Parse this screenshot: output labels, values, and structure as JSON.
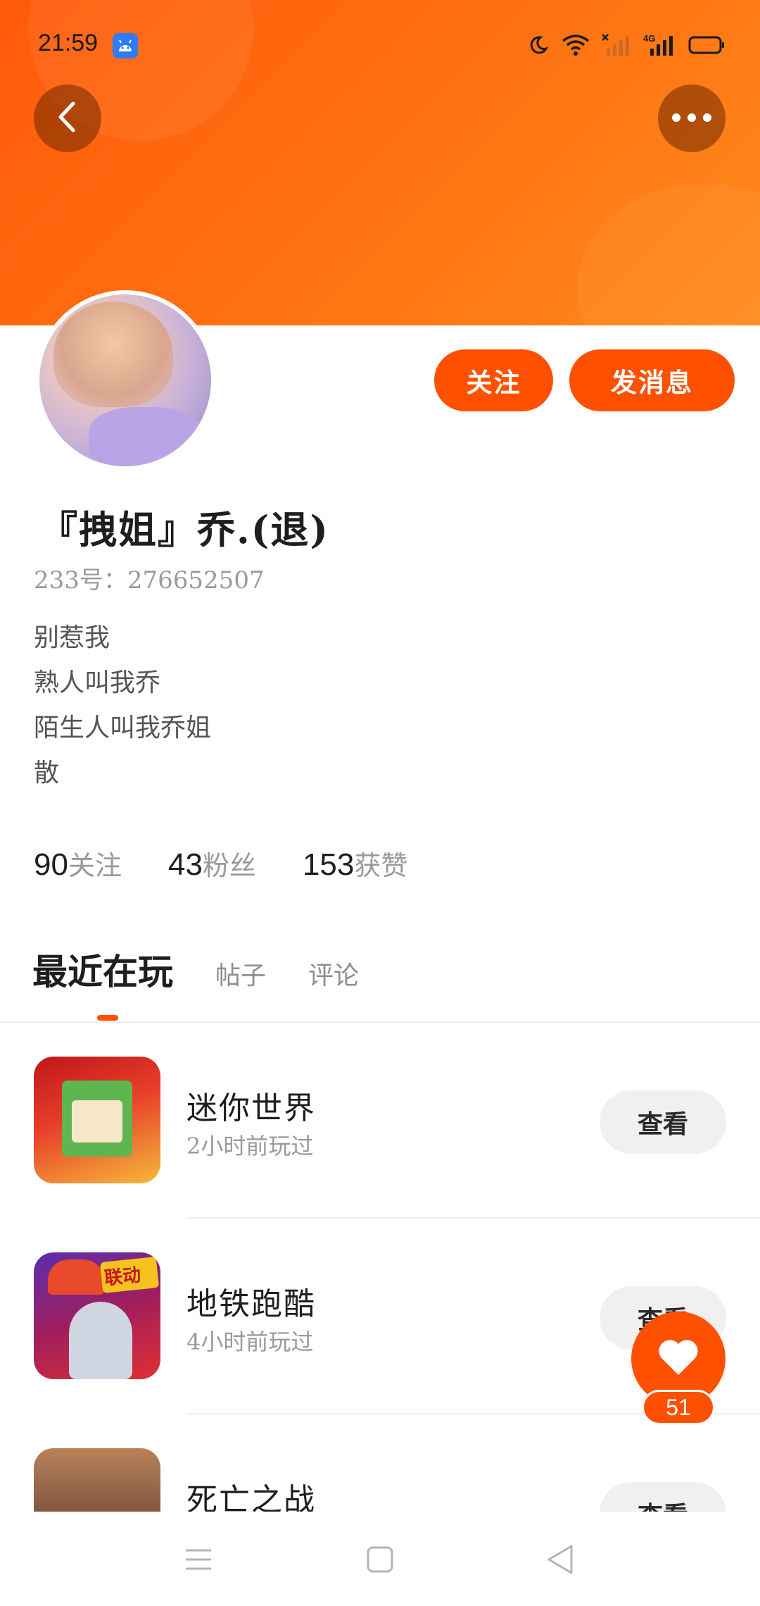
{
  "status_bar": {
    "time": "21:59",
    "network": "4G",
    "icons": [
      "android-app-icon",
      "moon-icon",
      "wifi-icon",
      "signal-x-icon",
      "signal-4g-icon",
      "battery-icon"
    ]
  },
  "header": {
    "back_icon": "chevron-left-icon",
    "more_icon": "more-dots-icon",
    "banner_color": "#ff6a10"
  },
  "profile": {
    "nickname": "『拽姐』乔.(退)",
    "uid": "233号：276652507",
    "follow_label": "关注",
    "message_label": "发消息",
    "bio": [
      "别惹我",
      "熟人叫我乔",
      "陌生人叫我乔姐",
      "散"
    ],
    "stats": [
      {
        "value": "90",
        "label": "关注"
      },
      {
        "value": "43",
        "label": "粉丝"
      },
      {
        "value": "153",
        "label": "获赞"
      }
    ]
  },
  "tabs": [
    {
      "label": "最近在玩",
      "active": true
    },
    {
      "label": "帖子",
      "active": false
    },
    {
      "label": "评论",
      "active": false
    }
  ],
  "games": [
    {
      "name": "迷你世界",
      "played": "2小时前玩过",
      "action": "查看"
    },
    {
      "name": "地铁跑酷",
      "played": "4小时前玩过",
      "action": "查看",
      "badge": "联动"
    },
    {
      "name": "死亡之战",
      "played": "",
      "action": "查看"
    }
  ],
  "like": {
    "count": "51",
    "icon": "heart-icon"
  },
  "accent_color": "#ff5000",
  "navbar": {
    "icons": [
      "menu-icon",
      "home-square-icon",
      "back-triangle-icon"
    ]
  }
}
